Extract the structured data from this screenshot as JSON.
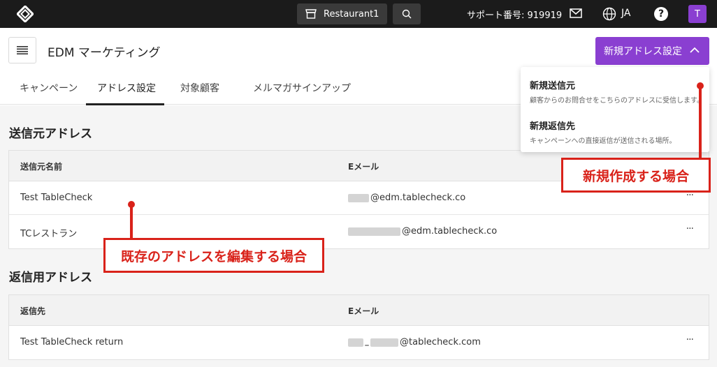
{
  "topbar": {
    "restaurant": "Restaurant1",
    "support_label": "サポート番号: 919919",
    "language": "JA",
    "help": "?",
    "avatar_initial": "T"
  },
  "header": {
    "title": "EDM マーケティング",
    "new_button": "新規アドレス設定"
  },
  "tabs": [
    {
      "label": "キャンペーン"
    },
    {
      "label": "アドレス設定"
    },
    {
      "label": "対象顧客"
    },
    {
      "label": "メルマガサインアップ"
    }
  ],
  "senders": {
    "title": "送信元アドレス",
    "columns": [
      "送信元名前",
      "Eメール"
    ],
    "rows": [
      {
        "name": "Test TableCheck",
        "email": "@edm.tablecheck.co"
      },
      {
        "name": "TCレストラン",
        "email": "@edm.tablecheck.co"
      }
    ]
  },
  "reply": {
    "title": "返信用アドレス",
    "columns": [
      "返信先",
      "Eメール"
    ],
    "rows": [
      {
        "name": "Test TableCheck return",
        "email": "@tablecheck.com"
      }
    ]
  },
  "dropdown": {
    "items": [
      {
        "title": "新規送信元",
        "desc": "顧客からのお問合せをこちらのアドレスに受信します。"
      },
      {
        "title": "新規返信先",
        "desc": "キャンペーンへの直接返信が送信される場所。"
      }
    ]
  },
  "annotations": {
    "new_case": "新規作成する場合",
    "edit_case": "既存のアドレスを編集する場合"
  },
  "more_glyph": "···",
  "colors": {
    "accent": "#8a3fd1",
    "topbar": "#1b1b1b",
    "annotation": "#d9221a"
  }
}
